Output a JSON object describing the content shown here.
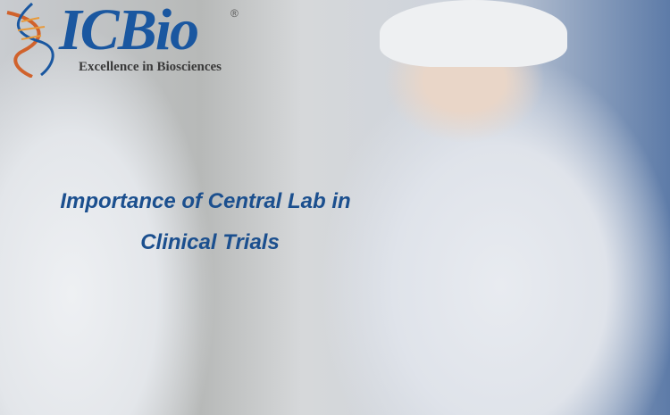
{
  "logo": {
    "brand": "ICBio",
    "registered": "®",
    "tagline": "Excellence in Biosciences"
  },
  "headline": {
    "line1": "Importance of Central Lab in",
    "line2": "Clinical Trials"
  },
  "colors": {
    "brand_blue": "#1a57a0",
    "title_blue": "#1b4f8e",
    "dna_orange": "#d0622c"
  }
}
